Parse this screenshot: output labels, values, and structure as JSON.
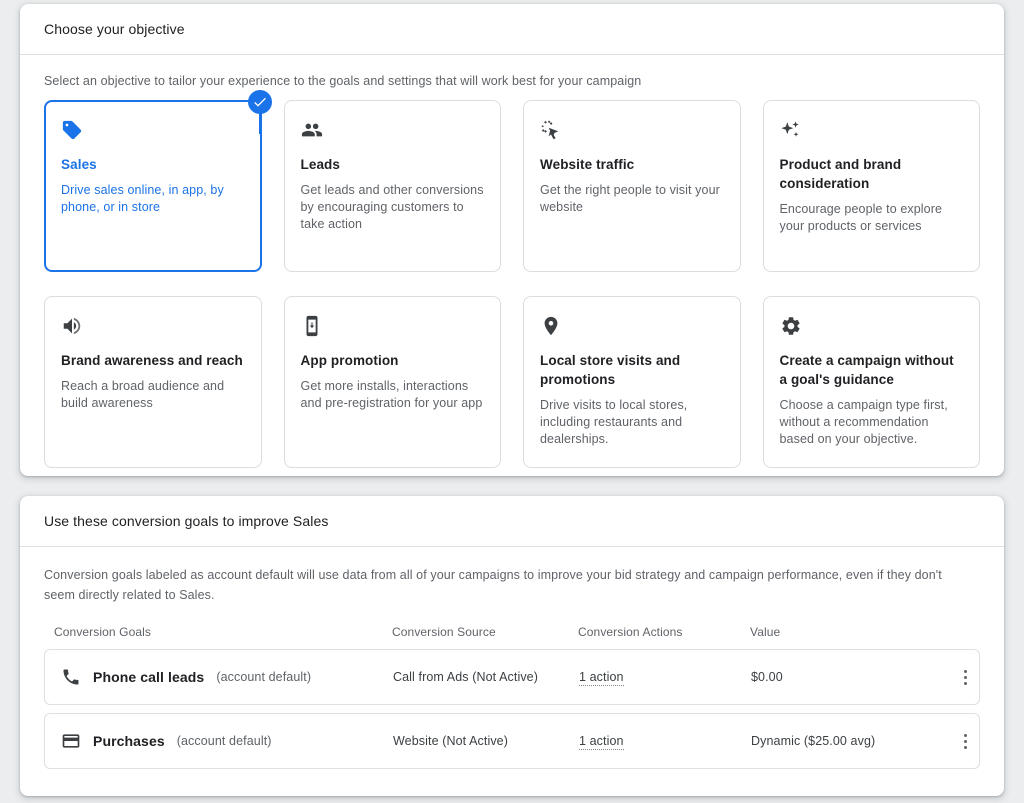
{
  "objective": {
    "header_title": "Choose your objective",
    "subtitle": "Select an objective to tailor your experience to the goals and settings that will work best for your campaign",
    "selected_index": 0,
    "accent_color": "#1a73e8",
    "cards": [
      {
        "icon": "tag-icon",
        "title": "Sales",
        "desc": "Drive sales online, in app, by phone, or in store",
        "selected": true
      },
      {
        "icon": "people-icon",
        "title": "Leads",
        "desc": "Get leads and other conversions by encouraging customers to take action",
        "selected": false
      },
      {
        "icon": "cursor-click-icon",
        "title": "Website traffic",
        "desc": "Get the right people to visit your website",
        "selected": false
      },
      {
        "icon": "sparkle-icon",
        "title": "Product and brand consideration",
        "desc": "Encourage people to explore your products or services",
        "selected": false
      },
      {
        "icon": "speaker-icon",
        "title": "Brand awareness and reach",
        "desc": "Reach a broad audience and build awareness",
        "selected": false
      },
      {
        "icon": "app-download-icon",
        "title": "App promotion",
        "desc": "Get more installs, interactions and pre-registration for your app",
        "selected": false
      },
      {
        "icon": "location-pin-icon",
        "title": "Local store visits and promotions",
        "desc": "Drive visits to local stores, including restaurants and dealerships.",
        "selected": false
      },
      {
        "icon": "gear-icon",
        "title": "Create a campaign without a goal's guidance",
        "desc": "Choose a campaign type first, without a recommendation based on your objective.",
        "selected": false
      }
    ]
  },
  "goals": {
    "header_title": "Use these conversion goals to improve Sales",
    "description": "Conversion goals labeled as account default will use data from all of your campaigns to improve your bid strategy and campaign performance, even if they don't seem directly related to Sales.",
    "columns": [
      "Conversion Goals",
      "Conversion Source",
      "Conversion Actions",
      "Value"
    ],
    "rows": [
      {
        "icon": "phone-icon",
        "name": "Phone call leads",
        "suffix": "(account default)",
        "source": "Call from Ads (Not Active)",
        "actions": "1 action",
        "value": "$0.00",
        "menu_icon": "more-vert-icon"
      },
      {
        "icon": "credit-card-icon",
        "name": "Purchases",
        "suffix": "(account default)",
        "source": "Website (Not Active)",
        "actions": "1 action",
        "value": "Dynamic ($25.00 avg)",
        "menu_icon": "more-vert-icon"
      }
    ]
  }
}
